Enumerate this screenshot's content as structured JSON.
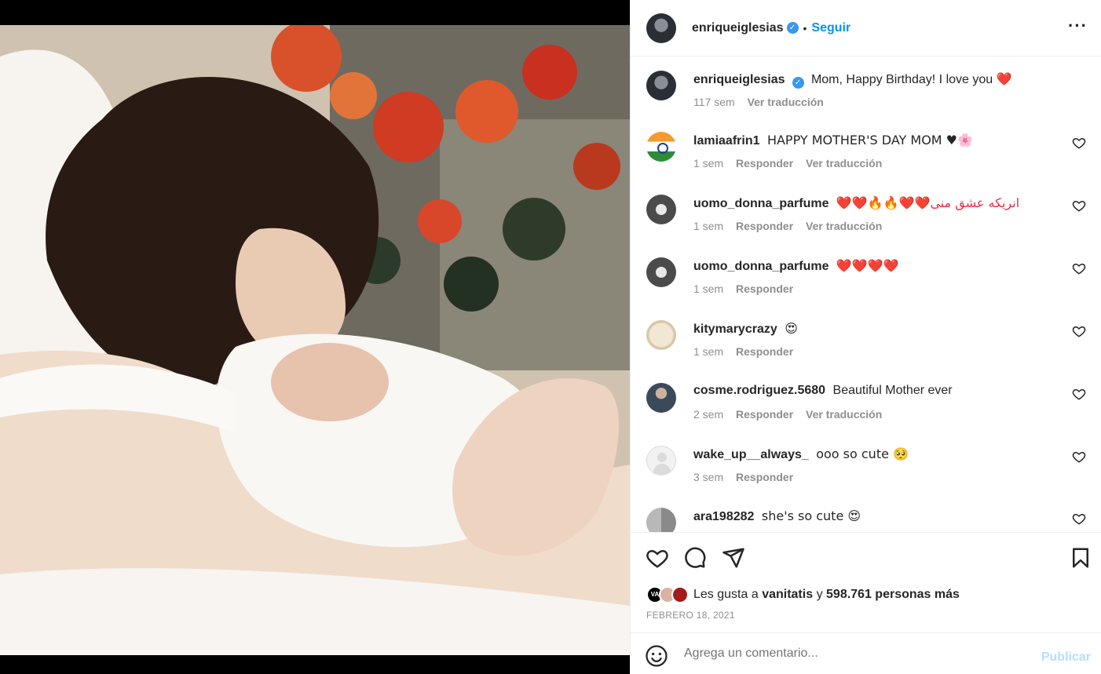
{
  "post": {
    "username": "enriqueiglesias",
    "follow_label": "Seguir",
    "more_icon": "more-options-icon"
  },
  "caption": {
    "username": "enriqueiglesias",
    "text": "Mom, Happy Birthday! I love you",
    "emoji": "❤️",
    "time": "117 sem",
    "translate": "Ver traducción"
  },
  "comments": [
    {
      "username": "lamiaafrin1",
      "text": "HAPPY MOTHER'S DAY MOM ♥🌸",
      "time": "1 sem",
      "reply": "Responder",
      "translate": "Ver traducción",
      "avatar": "india-flag"
    },
    {
      "username": "uomo_donna_parfume",
      "text": "❤️❤️🔥🔥❤️❤️انریکه عشق منی",
      "time": "1 sem",
      "reply": "Responder",
      "translate": "Ver traducción",
      "avatar": "perfume"
    },
    {
      "username": "uomo_donna_parfume",
      "text": "❤️❤️❤️❤️",
      "time": "1 sem",
      "reply": "Responder",
      "translate": "",
      "avatar": "perfume"
    },
    {
      "username": "kitymarycrazy",
      "text": "😍",
      "time": "1 sem",
      "reply": "Responder",
      "translate": "",
      "avatar": "kity"
    },
    {
      "username": "cosme.rodriguez.5680",
      "text": "Beautiful Mother ever",
      "time": "2 sem",
      "reply": "Responder",
      "translate": "Ver traducción",
      "avatar": "cosme"
    },
    {
      "username": "wake_up__always_",
      "text": "ooo so cute 🥺",
      "time": "3 sem",
      "reply": "Responder",
      "translate": "",
      "avatar": "default"
    },
    {
      "username": "ara198282",
      "text": "she's so cute 😍",
      "time": "",
      "reply": "",
      "translate": "",
      "avatar": "ara"
    }
  ],
  "likes": {
    "prefix": "Les gusta a",
    "user": "vanitatis",
    "conj": "y",
    "count": "598.761 personas más",
    "mini_avatar_text": "VA"
  },
  "date": "FEBRERO 18, 2021",
  "add_comment": {
    "placeholder": "Agrega un comentario...",
    "publish": "Publicar"
  },
  "colors": {
    "accent": "#0095f6",
    "publish_disabled": "#b2dffc",
    "heart_red": "#ed2d48",
    "verified": "#3897f0"
  }
}
